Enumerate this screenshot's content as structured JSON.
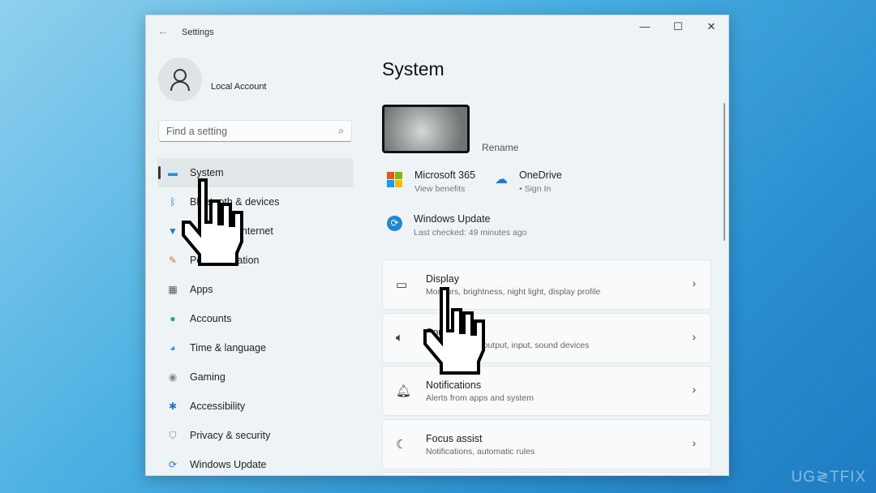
{
  "window": {
    "title": "Settings",
    "back_icon": "arrow-left-icon",
    "controls": [
      "minimize",
      "maximize",
      "close"
    ]
  },
  "account": {
    "name": "Local Account"
  },
  "search": {
    "placeholder": "Find a setting"
  },
  "sidebar": {
    "items": [
      {
        "label": "System",
        "icon": "monitor-icon",
        "color": "#2a8fd6",
        "selected": true
      },
      {
        "label": "Bluetooth & devices",
        "icon": "bluetooth-icon",
        "color": "#1e78d4"
      },
      {
        "label": "Network & internet",
        "icon": "wifi-icon",
        "color": "#1e78d4"
      },
      {
        "label": "Personalization",
        "icon": "brush-icon",
        "color": "#c77b3a"
      },
      {
        "label": "Apps",
        "icon": "apps-icon",
        "color": "#556"
      },
      {
        "label": "Accounts",
        "icon": "person-icon",
        "color": "#2aa56a"
      },
      {
        "label": "Time & language",
        "icon": "globe-icon",
        "color": "#2a8fd6"
      },
      {
        "label": "Gaming",
        "icon": "gamepad-icon",
        "color": "#888"
      },
      {
        "label": "Accessibility",
        "icon": "accessibility-icon",
        "color": "#1e78d4"
      },
      {
        "label": "Privacy & security",
        "icon": "shield-icon",
        "color": "#888"
      },
      {
        "label": "Windows Update",
        "icon": "update-icon",
        "color": "#1e78d4"
      }
    ]
  },
  "main": {
    "title": "System",
    "rename": "Rename",
    "quick": [
      {
        "title": "Microsoft 365",
        "sub": "View benefits"
      },
      {
        "title": "OneDrive",
        "sub": "• Sign In"
      },
      {
        "title": "Windows Update",
        "sub": "Last checked: 49 minutes ago"
      }
    ],
    "cards": [
      {
        "title": "Display",
        "sub": "Monitors, brightness, night light, display profile",
        "icon": "laptop-icon"
      },
      {
        "title": "Sound",
        "sub": "Volume levels, output, input, sound devices",
        "icon": "speaker-icon"
      },
      {
        "title": "Notifications",
        "sub": "Alerts from apps and system",
        "icon": "bell-icon"
      },
      {
        "title": "Focus assist",
        "sub": "Notifications, automatic rules",
        "icon": "moon-icon"
      }
    ]
  },
  "watermark": "UG≷TFIX"
}
